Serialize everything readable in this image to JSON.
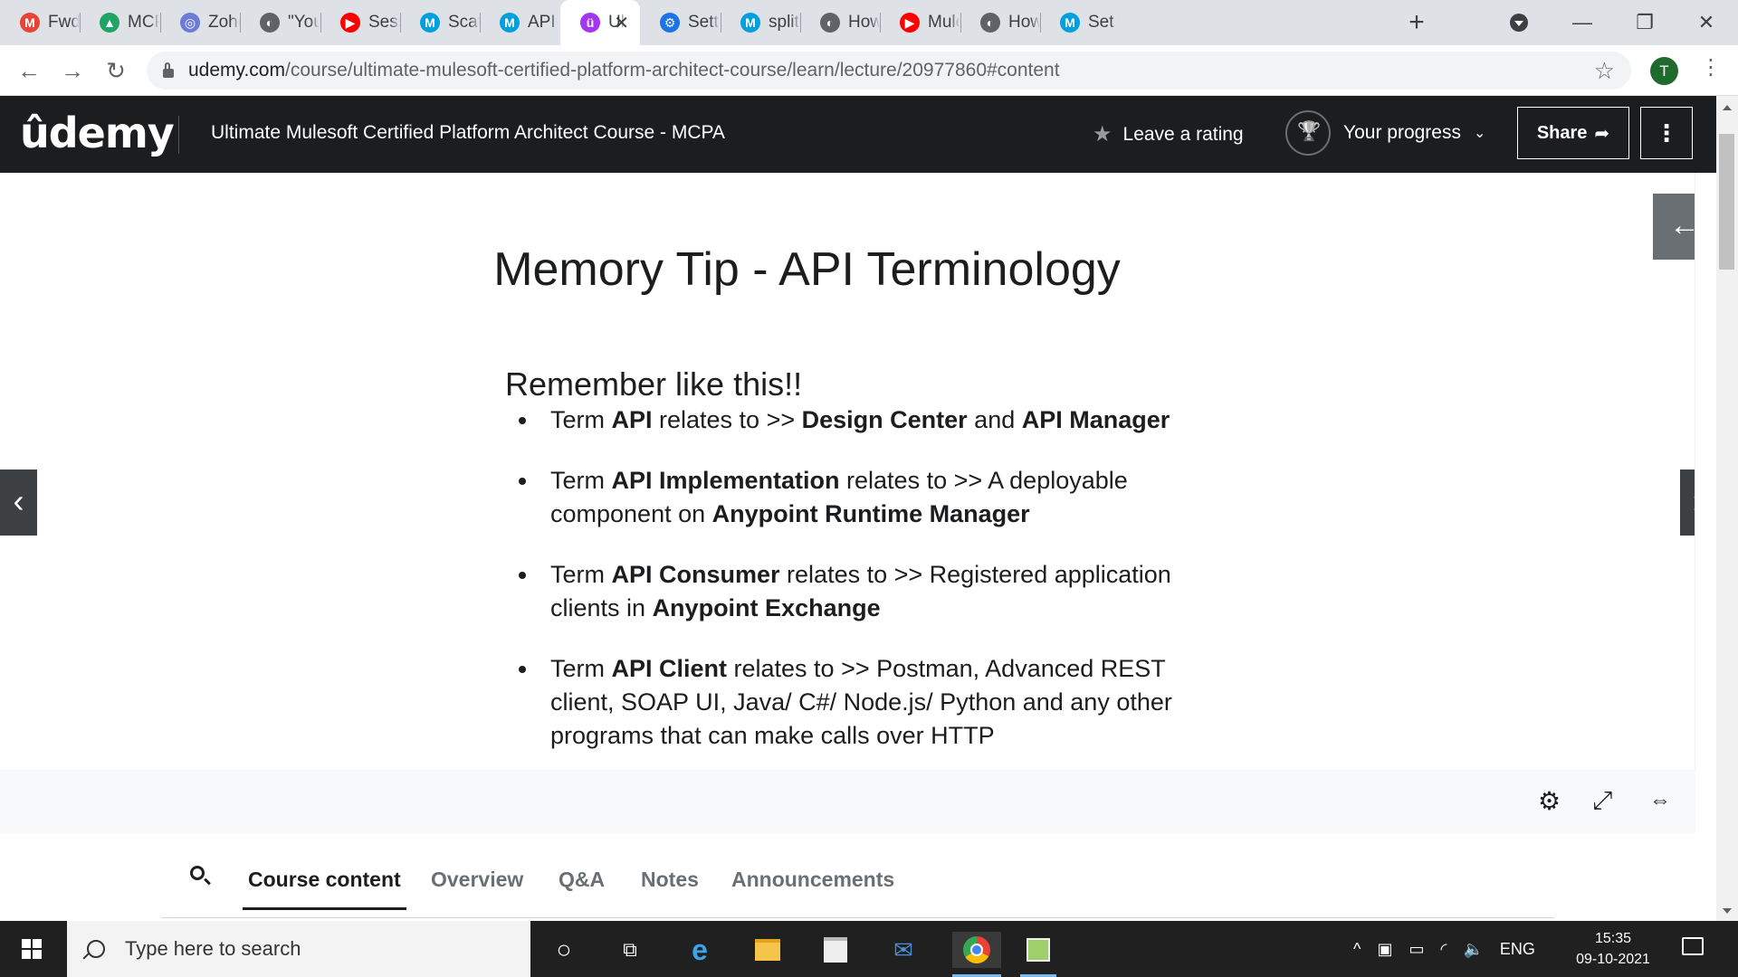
{
  "browser": {
    "tabs": [
      {
        "title": "Fwd: MCPA",
        "icon": "gmail-icon",
        "color": "#ea4335",
        "glyph": "M"
      },
      {
        "title": "MCPA",
        "icon": "drive-icon",
        "color": "#1fa463",
        "glyph": "▲"
      },
      {
        "title": "Zoho",
        "icon": "zoho-icon",
        "color": "#6b7bd6",
        "glyph": "◎"
      },
      {
        "title": "\"You c",
        "icon": "web-icon",
        "color": "#5f6368",
        "glyph": "◐"
      },
      {
        "title": "Sessio",
        "icon": "youtube-icon",
        "color": "#ff0000",
        "glyph": "▶"
      },
      {
        "title": "Scatte",
        "icon": "mulesoft-icon",
        "color": "#00a0df",
        "glyph": "M"
      },
      {
        "title": "API de",
        "icon": "mulesoft-icon",
        "color": "#00a0df",
        "glyph": "M"
      },
      {
        "title": "Ul",
        "icon": "udemy-icon",
        "color": "#a435f0",
        "glyph": "ü",
        "active": true
      },
      {
        "title": "Settin",
        "icon": "settings-icon",
        "color": "#1a73e8",
        "glyph": "⚙"
      },
      {
        "title": "splitBy",
        "icon": "mulesoft-icon",
        "color": "#00a0df",
        "glyph": "M"
      },
      {
        "title": "How t",
        "icon": "web-icon",
        "color": "#5f6368",
        "glyph": "◐"
      },
      {
        "title": "MuleS",
        "icon": "youtube-icon",
        "color": "#ff0000",
        "glyph": "▶"
      },
      {
        "title": "How t",
        "icon": "web-icon",
        "color": "#5f6368",
        "glyph": "◐"
      },
      {
        "title": "Set Va",
        "icon": "mulesoft-icon",
        "color": "#00a0df",
        "glyph": "M"
      }
    ],
    "url_domain": "udemy.com",
    "url_path": "/course/ultimate-mulesoft-certified-platform-architect-course/learn/lecture/20977860#content",
    "profile_initial": "T"
  },
  "header": {
    "logo": "ûdemy",
    "course_title": "Ultimate Mulesoft Certified Platform Architect Course - MCPA",
    "rating_label": "Leave a rating",
    "progress_label": "Your progress",
    "share_label": "Share"
  },
  "slide": {
    "title": "Memory Tip - API Terminology",
    "subtitle": "Remember like this!!",
    "bullets": [
      [
        {
          "t": "Term "
        },
        {
          "t": "API",
          "b": true
        },
        {
          "t": " relates to >> "
        },
        {
          "t": "Design Center",
          "b": true
        },
        {
          "t": " and "
        },
        {
          "t": "API Manager",
          "b": true
        }
      ],
      [
        {
          "t": "Term "
        },
        {
          "t": "API Implementation",
          "b": true
        },
        {
          "t": " relates to >> A deployable component on "
        },
        {
          "t": "Anypoint Runtime Manager",
          "b": true
        }
      ],
      [
        {
          "t": "Term "
        },
        {
          "t": "API Consumer",
          "b": true
        },
        {
          "t": " relates to >> Registered application clients in "
        },
        {
          "t": "Anypoint Exchange",
          "b": true
        }
      ],
      [
        {
          "t": "Term "
        },
        {
          "t": "API Client",
          "b": true
        },
        {
          "t": " relates to >> Postman, Advanced REST client, SOAP UI, Java/ C#/ Node.js/ Python and any other programs that can make calls over HTTP"
        }
      ]
    ]
  },
  "bottom_tabs": [
    "Course content",
    "Overview",
    "Q&A",
    "Notes",
    "Announcements"
  ],
  "taskbar": {
    "search_placeholder": "Type here to search",
    "language": "ENG",
    "time": "15:35",
    "date": "09-10-2021"
  }
}
